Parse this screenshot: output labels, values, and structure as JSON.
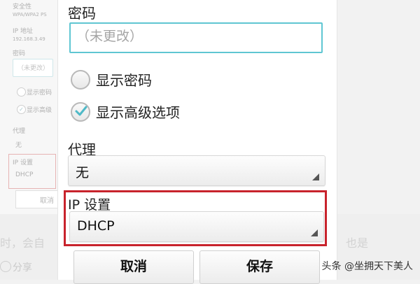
{
  "background": {
    "security_label": "安全性",
    "security_value": "WPA/WPA2 PS",
    "ip_label": "IP 地址",
    "ip_value": "192.168.3.49",
    "password_label": "密码",
    "password_placeholder": "（未更改）",
    "show_password": "显示密码",
    "show_advanced": "显示高级",
    "proxy_label": "代理",
    "proxy_value": "无",
    "ip_settings_label": "IP 设置",
    "ip_settings_value": "DHCP",
    "cancel": "取消",
    "share": "分享",
    "ghost_left": "时，会自",
    "ghost_right": "也是"
  },
  "dialog": {
    "password_label": "密码",
    "password_placeholder": "（未更改）",
    "show_password_label": "显示密码",
    "show_password_checked": false,
    "show_advanced_label": "显示高级选项",
    "show_advanced_checked": true,
    "proxy_label": "代理",
    "proxy_value": "无",
    "ip_settings_label": "IP 设置",
    "ip_settings_value": "DHCP",
    "cancel_button": "取消",
    "save_button": "保存"
  },
  "watermark": "头条 @坐拥天下美人",
  "colors": {
    "accent": "#5fc6d2",
    "highlight": "#c8232c"
  }
}
